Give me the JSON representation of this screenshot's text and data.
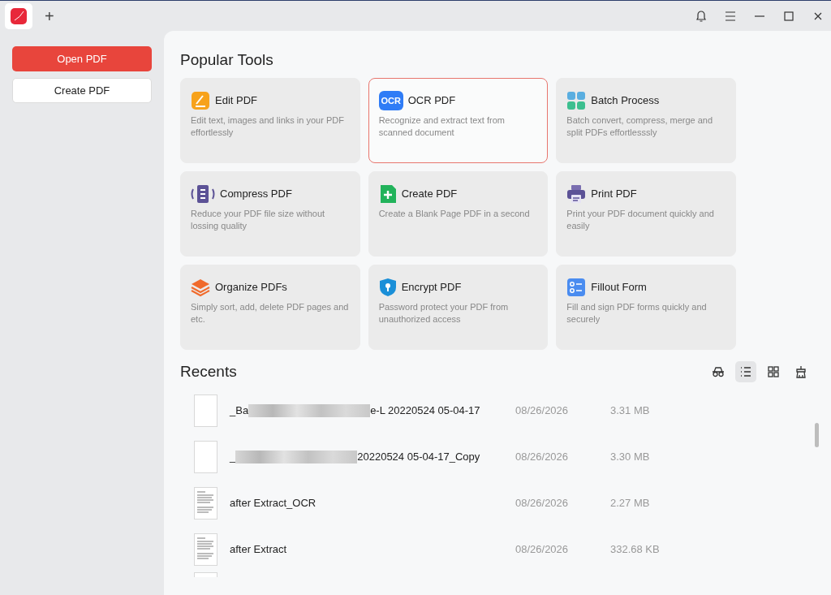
{
  "title_bar": {
    "new_tab": "+"
  },
  "sidebar": {
    "buttons": [
      {
        "label": "Open PDF",
        "kind": "primary"
      },
      {
        "label": "Create PDF",
        "kind": "secondary"
      }
    ]
  },
  "popular_tools": {
    "title": "Popular Tools",
    "tools": [
      {
        "kind": "edit",
        "name": "Edit PDF",
        "description": "Edit text, images and links in your PDF effortlessly",
        "selected": false
      },
      {
        "kind": "ocr",
        "icon_text": "OCR",
        "name": "OCR PDF",
        "description": "Recognize and extract text from scanned document",
        "selected": true
      },
      {
        "kind": "batch",
        "name": "Batch Process",
        "description": "Batch convert, compress, merge and split PDFs effortlesssly",
        "selected": false
      },
      {
        "kind": "compress",
        "name": "Compress PDF",
        "description": "Reduce your PDF file size without lossing quality",
        "selected": false
      },
      {
        "kind": "create",
        "name": "Create PDF",
        "description": "Create a Blank Page PDF in a second",
        "selected": false
      },
      {
        "kind": "print",
        "name": "Print PDF",
        "description": "Print your PDF document quickly and easily",
        "selected": false
      },
      {
        "kind": "organize",
        "name": "Organize PDFs",
        "description": "Simply sort, add, delete PDF pages and etc.",
        "selected": false
      },
      {
        "kind": "encrypt",
        "name": "Encrypt PDF",
        "description": "Password protect your PDF from unauthorized access",
        "selected": false
      },
      {
        "kind": "form",
        "name": "Fillout Form",
        "description": "Fill and sign PDF forms quickly and securely",
        "selected": false
      }
    ]
  },
  "recents": {
    "title": "Recents",
    "views": [
      {
        "kind": "glasses",
        "selected": false
      },
      {
        "kind": "list",
        "selected": true
      },
      {
        "kind": "grid",
        "selected": false
      },
      {
        "kind": "clean",
        "selected": false
      }
    ],
    "files": [
      {
        "kind": "blank",
        "name_start": "_Ba",
        "redacted": true,
        "name_end": "e-L 20220524 05-04-17",
        "date": "08/26/2026",
        "size": "3.31 MB"
      },
      {
        "kind": "blank",
        "name_start": "_",
        "redacted": true,
        "name_end": "20220524 05-04-17_Copy",
        "date": "08/26/2026",
        "size": "3.30 MB"
      },
      {
        "kind": "text",
        "name_start": "after Extract_OCR",
        "redacted": false,
        "date": "08/26/2026",
        "size": "2.27 MB"
      },
      {
        "kind": "text",
        "name_start": "after Extract",
        "redacted": false,
        "date": "08/26/2026",
        "size": "332.68 KB"
      }
    ]
  }
}
